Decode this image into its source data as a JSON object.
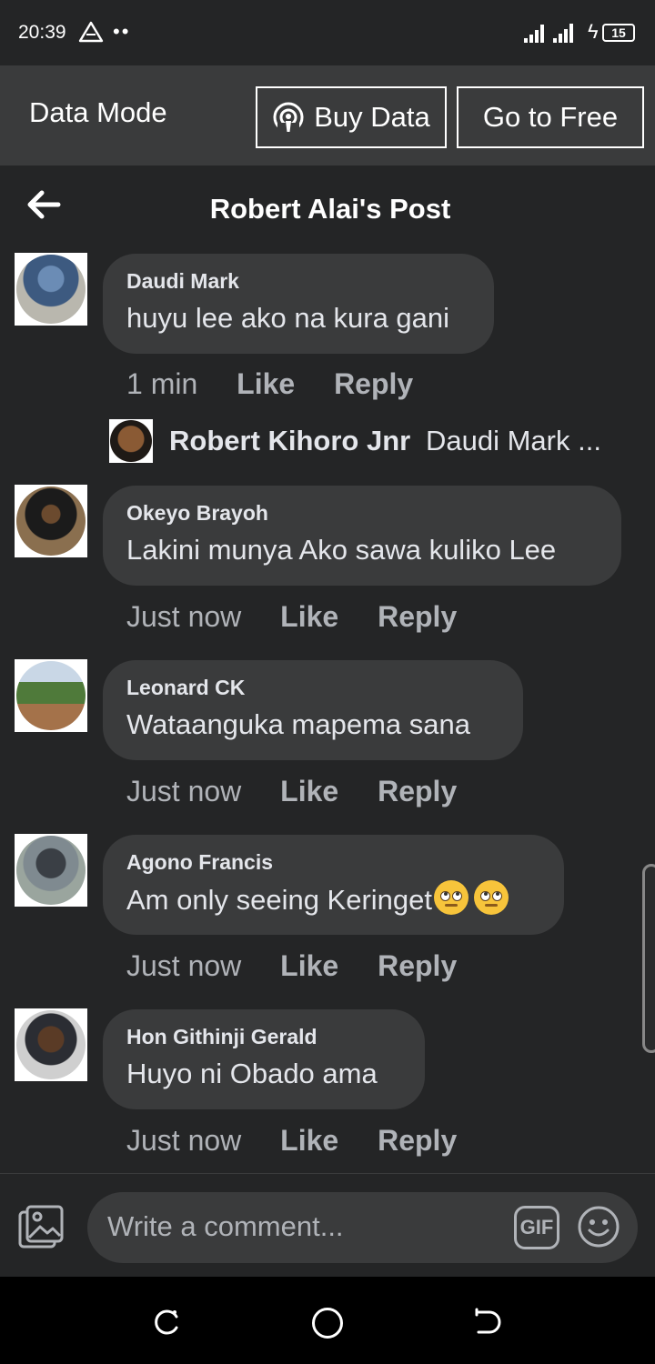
{
  "status_bar": {
    "time": "20:39",
    "dots": "••",
    "battery": "15"
  },
  "data_banner": {
    "title": "Data Mode",
    "buy_label": "Buy Data",
    "free_label": "Go to Free"
  },
  "header": {
    "title": "Robert Alai's Post"
  },
  "comments": [
    {
      "name": "Daudi Mark",
      "text": "huyu lee ako na kura gani",
      "time": "1 min",
      "like": "Like",
      "reply": "Reply"
    },
    {
      "name": "Okeyo Brayoh",
      "text": "Lakini munya Ako sawa kuliko Lee",
      "time": "Just now",
      "like": "Like",
      "reply": "Reply"
    },
    {
      "name": "Leonard CK",
      "text": "Wataanguka mapema sana",
      "time": "Just now",
      "like": "Like",
      "reply": "Reply"
    },
    {
      "name": "Agono Francis",
      "text": "Am only seeing Keringet",
      "time": "Just now",
      "like": "Like",
      "reply": "Reply"
    },
    {
      "name": "Hon Githinji Gerald",
      "text": "Huyo ni Obado ama",
      "time": "Just now",
      "like": "Like",
      "reply": "Reply"
    }
  ],
  "reply_preview": {
    "name": "Robert Kihoro Jnr",
    "text": "Daudi Mark ..."
  },
  "composer": {
    "placeholder": "Write a comment...",
    "gif_label": "GIF"
  },
  "icons": [
    "warning-icon",
    "signal-icon",
    "bolt-icon",
    "battery-icon",
    "podcast-icon",
    "back-arrow-icon",
    "photo-icon",
    "gif-icon",
    "smile-icon",
    "recent-apps-icon",
    "home-icon",
    "nav-back-icon"
  ],
  "colors": {
    "background": "#242526",
    "bubble": "#3a3b3c",
    "banner": "#3a3b3c",
    "text": "#e4e6eb",
    "muted": "#b0b3b8"
  }
}
